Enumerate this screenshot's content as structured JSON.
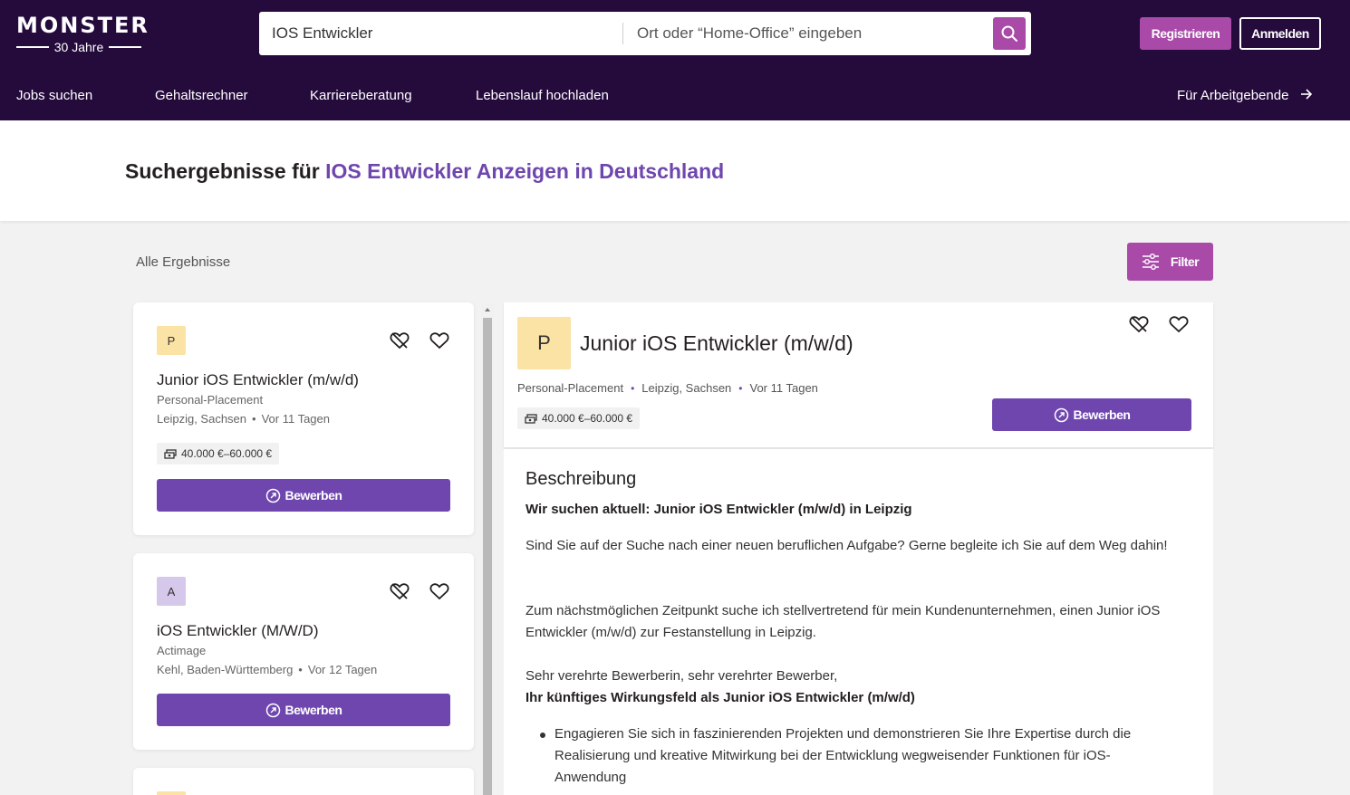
{
  "header": {
    "logo": {
      "word": "MONSTER",
      "sub": "30 Jahre"
    },
    "search": {
      "query": "IOS Entwickler",
      "location_placeholder": "Ort oder “Home-Office” eingeben"
    },
    "register_label": "Registrieren",
    "login_label": "Anmelden",
    "nav": [
      "Jobs suchen",
      "Gehaltsrechner",
      "Karriereberatung",
      "Lebenslauf hochladen"
    ],
    "employer_link": "Für Arbeitgebende"
  },
  "results": {
    "title_prefix": "Suchergebnisse für",
    "title_highlight": "IOS Entwickler Anzeigen in Deutschland",
    "all_label": "Alle Ergebnisse",
    "filter_label": "Filter"
  },
  "jobs": [
    {
      "logo_letter": "P",
      "logo_color": "#fbe3a6",
      "title": "Junior iOS Entwickler (m/w/d)",
      "company": "Personal-Placement",
      "location": "Leipzig, Sachsen",
      "age": "Vor 11 Tagen",
      "salary": "40.000 €–60.000 €",
      "apply_label": "Bewerben"
    },
    {
      "logo_letter": "A",
      "logo_color": "#d6c8ea",
      "title": "iOS Entwickler (M/W/D)",
      "company": "Actimage",
      "location": "Kehl, Baden-Württemberg",
      "age": "Vor 12 Tagen",
      "apply_label": "Bewerben"
    }
  ],
  "detail": {
    "logo_letter": "P",
    "title": "Junior iOS Entwickler (m/w/d)",
    "company": "Personal-Placement",
    "location": "Leipzig, Sachsen",
    "age": "Vor 11 Tagen",
    "salary": "40.000 €–60.000 €",
    "apply_label": "Bewerben",
    "description_heading": "Beschreibung",
    "intro_bold": "Wir suchen aktuell: Junior iOS Entwickler (m/w/d) in Leipzig",
    "para1": "Sind Sie auf der Suche nach einer neuen beruflichen Aufgabe? Gerne begleite ich Sie auf dem Weg dahin!",
    "para2": "Zum nächstmöglichen Zeitpunkt suche ich stellvertretend für mein Kundenunternehmen, einen Junior iOS Entwickler (m/w/d) zur Festanstellung in Leipzig.",
    "greeting": "Sehr verehrte Bewerberin, sehr verehrter Bewerber,",
    "section_bold": "Ihr künftiges Wirkungsfeld als Junior iOS Entwickler (m/w/d)",
    "bullet1": "Engagieren Sie sich in faszinierenden Projekten und demonstrieren Sie Ihre Expertise durch die Realisierung und kreative Mitwirkung bei der Entwicklung wegweisender Funktionen für iOS-Anwendung"
  },
  "colors": {
    "header_bg": "#250a3c",
    "accent_purple": "#6e46ae",
    "accent_pink": "#a94aa9"
  }
}
